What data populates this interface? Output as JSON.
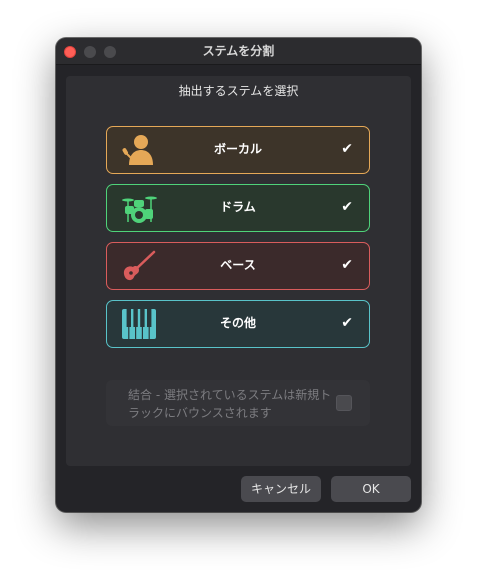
{
  "window": {
    "title": "ステムを分割",
    "subtitle": "抽出するステムを選択"
  },
  "stems": [
    {
      "label": "ボーカル",
      "icon": "vocalist-icon",
      "checked": true,
      "check": "✔",
      "color": "#e5a857"
    },
    {
      "label": "ドラム",
      "icon": "drum-kit-icon",
      "checked": true,
      "check": "✔",
      "color": "#4fd37a"
    },
    {
      "label": "ベース",
      "icon": "bass-guitar-icon",
      "checked": true,
      "check": "✔",
      "color": "#d95c5c"
    },
    {
      "label": "その他",
      "icon": "piano-keys-icon",
      "checked": true,
      "check": "✔",
      "color": "#59c3c9"
    }
  ],
  "merge": {
    "line1": "結合 - 選択されているステムは新規ト",
    "line2": "ラックにバウンスされます",
    "checked": false,
    "enabled": false
  },
  "buttons": {
    "cancel": "キャンセル",
    "ok": "OK"
  },
  "colors": {
    "close": "#ff5f57",
    "background": "#242428"
  }
}
